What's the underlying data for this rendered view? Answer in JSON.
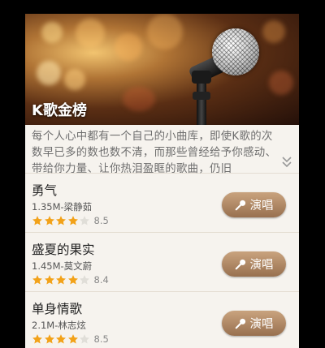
{
  "banner": {
    "title": "K歌金榜"
  },
  "description": {
    "text": "每个人心中都有一个自己的小曲库，即使K歌的次数早已多的数也数不清，而那些曾经给予你感动、带给你力量、让你热泪盈眶的歌曲，仍旧"
  },
  "colors": {
    "star_on": "#f2a219",
    "star_off": "#e0ded8",
    "button": "#a47b58"
  },
  "songs": [
    {
      "title": "勇气",
      "meta": "1.35M-梁静茹",
      "rating": 4,
      "score": "8.5",
      "button_label": "演唱"
    },
    {
      "title": "盛夏的果实",
      "meta": "1.45M-莫文蔚",
      "rating": 4,
      "score": "8.4",
      "button_label": "演唱"
    },
    {
      "title": "单身情歌",
      "meta": "2.1M-林志炫",
      "rating": 4,
      "score": "8.5",
      "button_label": "演唱"
    }
  ]
}
